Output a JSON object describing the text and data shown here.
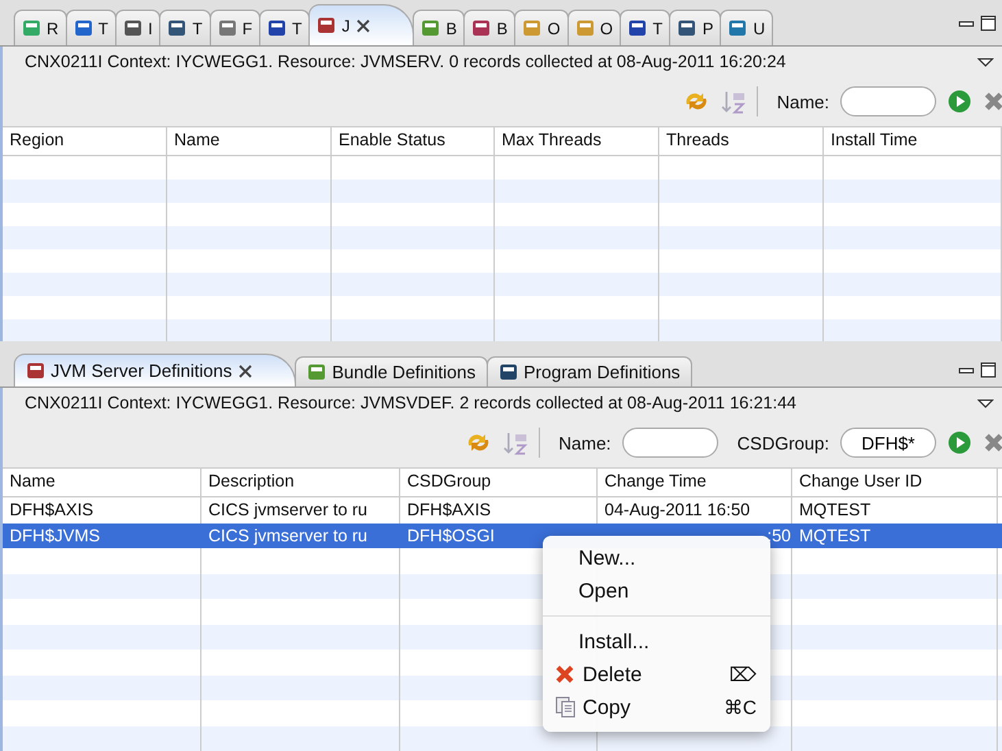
{
  "top_view": {
    "tabs": [
      {
        "label": "R",
        "selected": false
      },
      {
        "label": "T",
        "selected": false
      },
      {
        "label": "I",
        "selected": false
      },
      {
        "label": "T",
        "selected": false
      },
      {
        "label": "F",
        "selected": false
      },
      {
        "label": "T",
        "selected": false
      },
      {
        "label": "J",
        "selected": true
      },
      {
        "label": "B",
        "selected": false
      },
      {
        "label": "B",
        "selected": false
      },
      {
        "label": "O",
        "selected": false
      },
      {
        "label": "O",
        "selected": false
      },
      {
        "label": "T",
        "selected": false
      },
      {
        "label": "P",
        "selected": false
      },
      {
        "label": "U",
        "selected": false
      }
    ],
    "message": "CNX0211I Context: IYCWEGG1. Resource: JVMSERV. 0 records collected at 08-Aug-2011 16:20:24",
    "filters": [
      {
        "label": "Name:"
      }
    ],
    "table": {
      "columns": [
        "Region",
        "Name",
        "Enable Status",
        "Max Threads",
        "Threads",
        "Install Time"
      ]
    }
  },
  "bottom_view": {
    "tabs": [
      {
        "label": "JVM Server Definitions",
        "selected": true
      },
      {
        "label": "Bundle Definitions",
        "selected": false
      },
      {
        "label": "Program Definitions",
        "selected": false
      }
    ],
    "message": "CNX0211I Context: IYCWEGG1. Resource: JVMSVDEF. 2 records collected at 08-Aug-2011 16:21:44",
    "filters": [
      {
        "label": "Name:"
      },
      {
        "label": "CSDGroup:",
        "value": "DFH$*"
      }
    ],
    "table": {
      "columns": [
        "Name",
        "Description",
        "CSDGroup",
        "Change Time",
        "Change User ID"
      ],
      "rows": [
        {
          "selected": false,
          "cells": [
            "DFH$AXIS",
            "CICS jvmserver to ru",
            "DFH$AXIS",
            "04-Aug-2011 16:50",
            "MQTEST"
          ]
        },
        {
          "selected": true,
          "cells": [
            "DFH$JVMS",
            "CICS jvmserver to ru",
            "DFH$OSGI",
            ":50",
            "MQTEST"
          ]
        }
      ]
    }
  },
  "context_menu": {
    "items": [
      {
        "kind": "plain",
        "label": "New..."
      },
      {
        "kind": "plain",
        "label": "Open"
      },
      {
        "kind": "separator"
      },
      {
        "kind": "plain",
        "label": "Install..."
      },
      {
        "kind": "delete",
        "label": "Delete",
        "shortcut": "⌦"
      },
      {
        "kind": "copy",
        "label": "Copy",
        "shortcut": "⌘C"
      }
    ]
  }
}
